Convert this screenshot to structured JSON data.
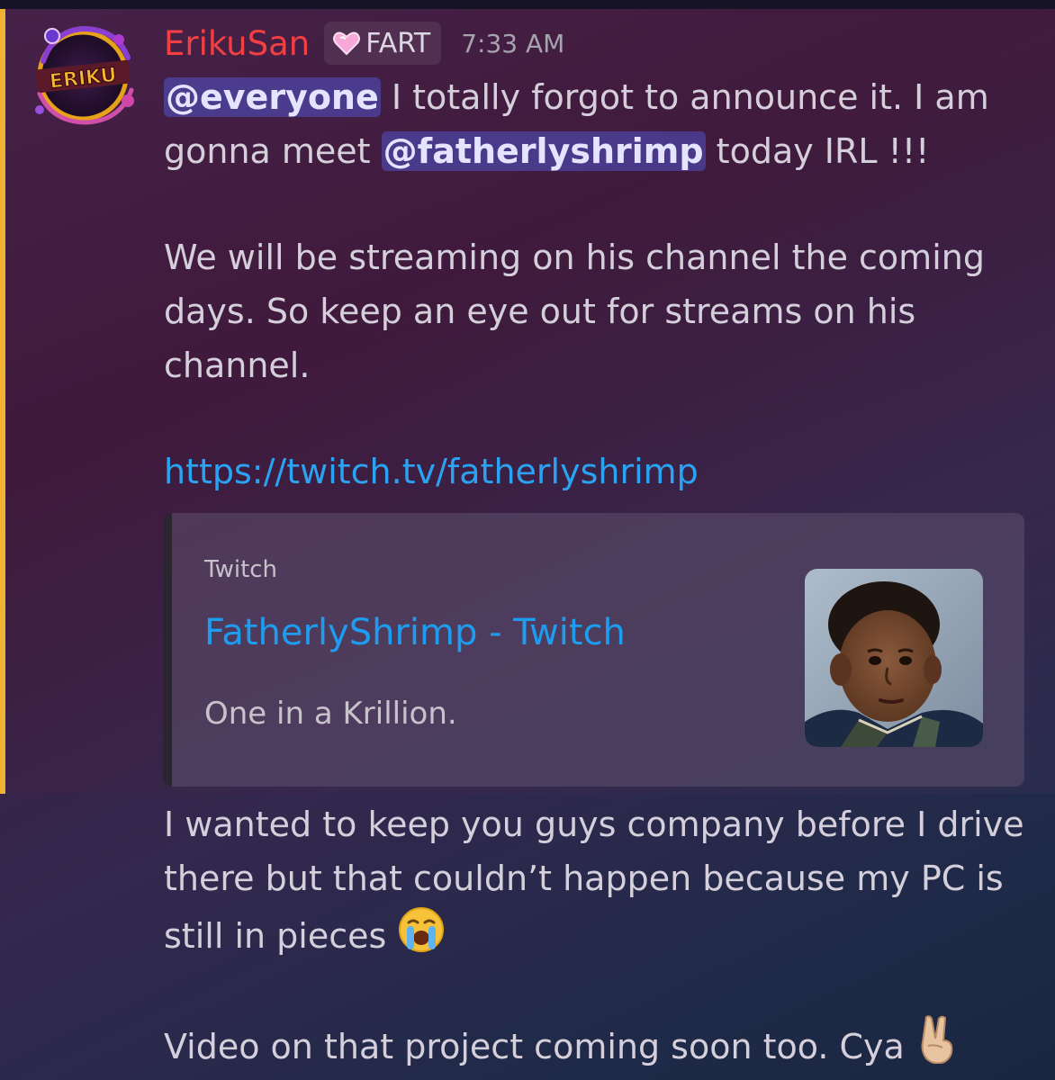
{
  "message": {
    "author": {
      "username": "ErikuSan",
      "avatar_text": "ERIKU",
      "role_tag": "FART",
      "role_icon": "pink-heart-icon"
    },
    "timestamp": "7:33 AM",
    "line1": {
      "mention": "@everyone",
      "text": " I totally forgot to announce it. I am"
    },
    "line2": {
      "pre": "gonna meet ",
      "mention": "@fatherlyshrimp",
      "post": " today IRL !!!"
    },
    "para2": [
      "We will be streaming on his channel the coming",
      "days. So keep an eye out for streams on his",
      "channel."
    ],
    "link": "https://twitch.tv/fatherlyshrimp",
    "embed": {
      "provider": "Twitch",
      "title": "FatherlyShrimp - Twitch",
      "description": "One in a Krillion.",
      "thumbnail": "child-portrait-photo"
    },
    "para3": [
      "I wanted to keep you guys company before I drive",
      "there but that couldn’t happen because my PC is",
      "still in pieces "
    ],
    "para3_emoji": "loudly-crying-face-emoji",
    "para4": "Video on that project coming soon too. Cya ",
    "para4_emoji": "victory-hand-emoji",
    "colors": {
      "username": "#f23f43",
      "mention_bg": "#5865f2",
      "link": "#29a3f2",
      "highlight_bar": "#f0b232"
    }
  }
}
